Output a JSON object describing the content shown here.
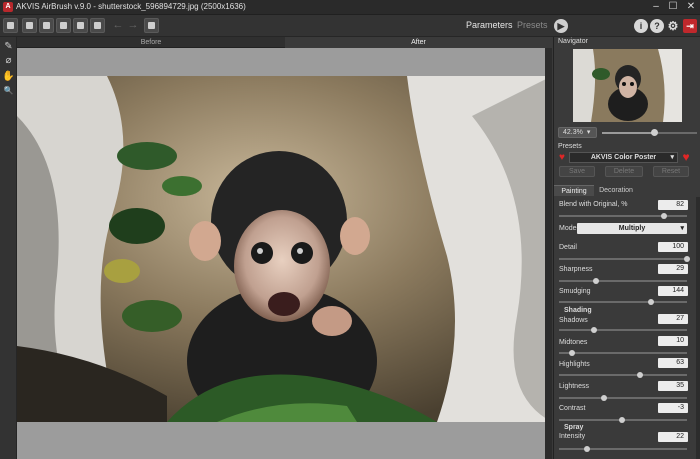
{
  "window": {
    "title": "AKVIS AirBrush v.9.0 - shutterstock_596894729.jpg (2500x1636)",
    "logo": "A"
  },
  "window_buttons": {
    "minimize": "–",
    "maximize": "☐",
    "close": "✕"
  },
  "toolbar": {
    "icons": [
      "home-icon",
      "open-icon",
      "save-icon",
      "print-icon",
      "share-icon",
      "batch-icon",
      "undo-icon",
      "redo-icon",
      "settings-icon"
    ],
    "undo": "←",
    "redo": "→",
    "tab_parameters": "Parameters",
    "tab_presets": "Presets",
    "run_glyph": "▶",
    "info": "i",
    "help": "?",
    "gear": "⚙",
    "exit": "⇥"
  },
  "tools": {
    "brush": "✎",
    "eraser": "⌀",
    "hand": "✋",
    "zoom": "🔍"
  },
  "view": {
    "before": "Before",
    "after": "After"
  },
  "navigator": {
    "title": "Navigator",
    "zoom": "42.3%",
    "zoom_arrow": "▾",
    "zoom_fraction": 0.55
  },
  "presets": {
    "title": "Presets",
    "selected": "AKVIS Color Poster",
    "arrow": "▾",
    "heart": "♥",
    "save": "Save",
    "delete": "Delete",
    "reset": "Reset"
  },
  "tabs": {
    "painting": "Painting",
    "decoration": "Decoration"
  },
  "params": {
    "blend": {
      "label": "Blend with Original, %",
      "value": "82",
      "fraction": 0.82
    },
    "mode": {
      "label": "Mode:",
      "value": "Multiply",
      "arrow": "▾"
    },
    "detail": {
      "label": "Detail",
      "value": "100",
      "fraction": 1.0
    },
    "sharpness": {
      "label": "Sharpness",
      "value": "29",
      "fraction": 0.29
    },
    "smudging": {
      "label": "Smudging",
      "value": "144",
      "fraction": 0.72
    },
    "shading_title": "Shading",
    "shadows": {
      "label": "Shadows",
      "value": "27",
      "fraction": 0.27
    },
    "midtones": {
      "label": "Midtones",
      "value": "10",
      "fraction": 0.1
    },
    "highlights": {
      "label": "Highlights",
      "value": "63",
      "fraction": 0.63
    },
    "lightness": {
      "label": "Lightness",
      "value": "35",
      "fraction": 0.35
    },
    "contrast": {
      "label": "Contrast",
      "value": "-3",
      "fraction": 0.49
    },
    "spray_title": "Spray",
    "intensity": {
      "label": "Intensity",
      "value": "22",
      "fraction": 0.22
    }
  },
  "colors": {
    "accent_red": "#e02626",
    "panel_bg": "#3a3a3a",
    "canvas_bg": "#9c9c9c"
  }
}
